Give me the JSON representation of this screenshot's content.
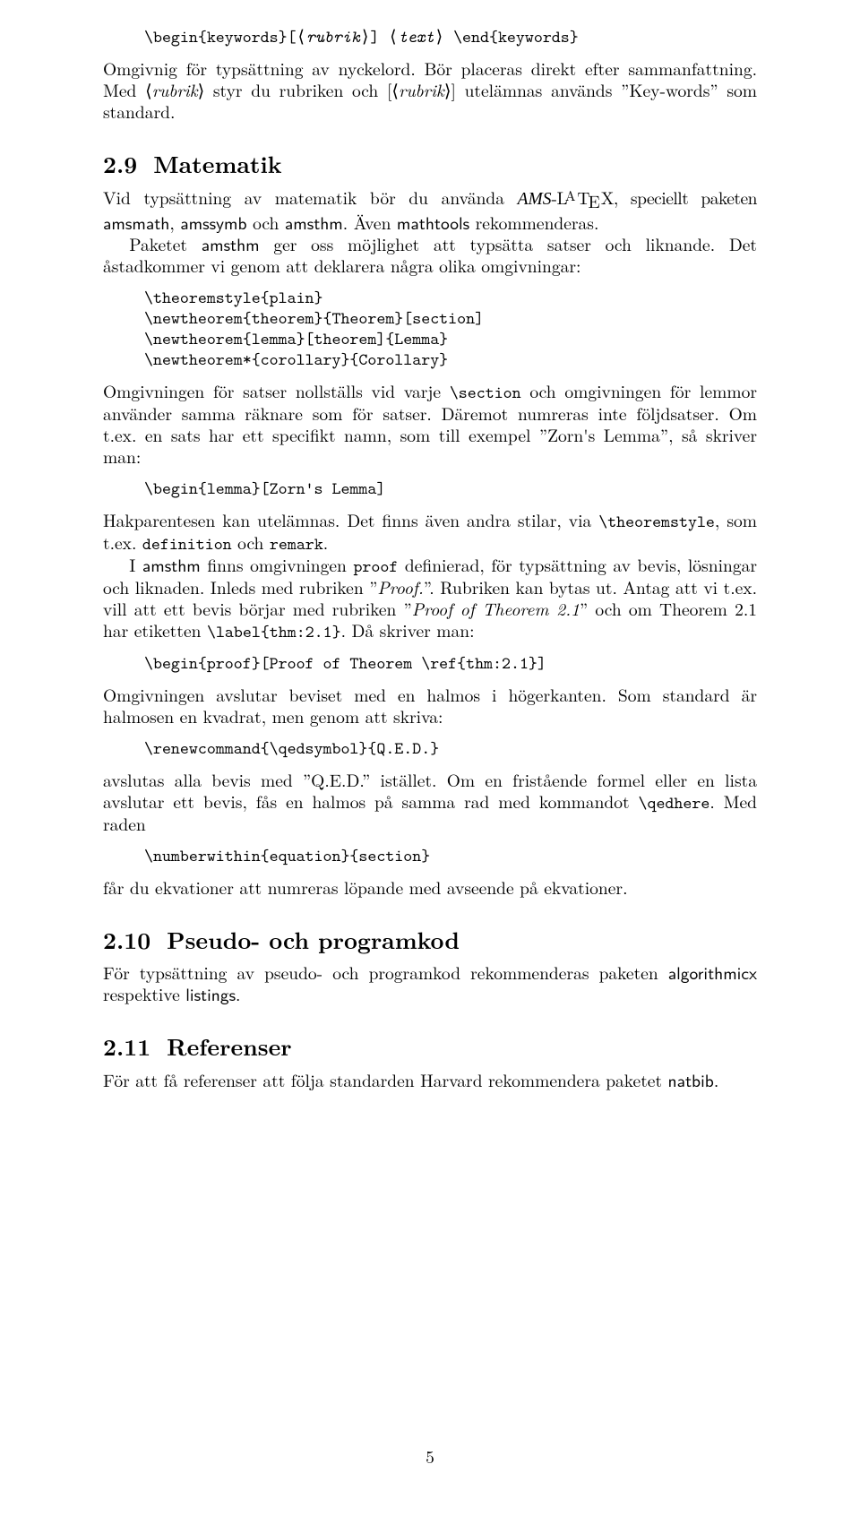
{
  "top_cmd": {
    "begin": "\\begin{keywords}[",
    "rubrik": "rubrik",
    "mid": "] ",
    "text": "text",
    "end": " \\end{keywords}"
  },
  "keywords_para1_a": "Omgivnig för typsättning av nyckelord. Bör placeras direkt efter sammanfattning. Med ⟨",
  "keywords_para1_r1": "rubrik",
  "keywords_para1_b": "⟩ styr du rubriken och [⟨",
  "keywords_para1_r2": "rubrik",
  "keywords_para1_c": "⟩] utelämnas används ”Key-words” som standard.",
  "sec29_num": "2.9",
  "sec29_title": "Matematik",
  "sec29_p1_a": "Vid typsättning av matematik bör du använda ",
  "sec29_p1_ams": "AMS",
  "sec29_p1_b": "-L",
  "sec29_p1_c": "T",
  "sec29_p1_d": "X, speciellt paketen ",
  "sec29_pk1": "amsmath",
  "sec29_pk_sep1": ", ",
  "sec29_pk2": "amssymb",
  "sec29_pk_and": " och ",
  "sec29_pk3": "amsthm",
  "sec29_p1_e": ". Även ",
  "sec29_pk4": "mathtools",
  "sec29_p1_f": " rekommenderas.",
  "sec29_p2_a": "Paketet ",
  "sec29_p2_pkg": "amsthm",
  "sec29_p2_b": " ger oss möjlighet att typsätta satser och liknande. Det åstadkommer vi genom att deklarera några olika omgivningar:",
  "code1": "\\theoremstyle{plain}\n\\newtheorem{theorem}{Theorem}[section]\n\\newtheorem{lemma}[theorem]{Lemma}\n\\newtheorem*{corollary}{Corollary}",
  "sec29_p3_a": "Omgivningen för satser nollställs vid varje ",
  "sec29_p3_sec": "\\section",
  "sec29_p3_b": " och omgivningen för lemmor använder samma räknare som för satser. Däremot numreras inte följdsatser. Om t.ex. en sats har ett specifikt namn, som till exempel ”Zorn's Lemma”, så skriver man:",
  "code2": "\\begin{lemma}[Zorn's Lemma]",
  "sec29_p4_a": "Hakparentesen kan utelämnas. Det finns även andra stilar, via ",
  "sec29_p4_ts": "\\theoremstyle",
  "sec29_p4_b": ", som t.ex. ",
  "sec29_p4_def": "definition",
  "sec29_p4_c": " och ",
  "sec29_p4_rem": "remark",
  "sec29_p4_d": ".",
  "sec29_p5_a": "I ",
  "sec29_p5_pkg": "amsthm",
  "sec29_p5_b": " finns omgivningen ",
  "sec29_p5_proof": "proof",
  "sec29_p5_c": " definierad, för typsättning av bevis, lösningar och liknaden. Inleds med rubriken ”",
  "sec29_p5_proofit": "Proof.",
  "sec29_p5_d": "”. Rubriken kan bytas ut. Antag att vi t.ex. vill att ett bevis börjar med rubriken ”",
  "sec29_p5_pot": "Proof of Theorem 2.1",
  "sec29_p5_e": "” och om Theorem 2.1 har etiketten ",
  "sec29_p5_label": "\\label{thm:2.1}",
  "sec29_p5_f": ". Då skriver man:",
  "code3": "\\begin{proof}[Proof of Theorem \\ref{thm:2.1}]",
  "sec29_p6": "Omgivningen avslutar beviset med en halmos i högerkanten. Som standard är halmosen en kvadrat, men genom att skriva:",
  "code4": "\\renewcommand{\\qedsymbol}{Q.E.D.}",
  "sec29_p7_a": "avslutas alla bevis med ”Q.E.D.” istället. Om en fristående formel eller en lista avslutar ett bevis, fås en halmos på samma rad med kommandot ",
  "sec29_p7_qed": "\\qedhere",
  "sec29_p7_b": ". Med raden",
  "code5": "\\numberwithin{equation}{section}",
  "sec29_p8": "får du ekvationer att numreras löpande med avseende på ekvationer.",
  "sec210_num": "2.10",
  "sec210_title": "Pseudo- och programkod",
  "sec210_p_a": "För typsättning av pseudo- och programkod rekommenderas paketen ",
  "sec210_alg": "algorithmicx",
  "sec210_p_b": " respektive ",
  "sec210_lst": "listings",
  "sec210_p_c": ".",
  "sec211_num": "2.11",
  "sec211_title": "Referenser",
  "sec211_p_a": "För att få referenser att följa standarden Harvard rekommendera paketet ",
  "sec211_nat": "natbib",
  "sec211_p_b": ".",
  "pagenum": "5"
}
